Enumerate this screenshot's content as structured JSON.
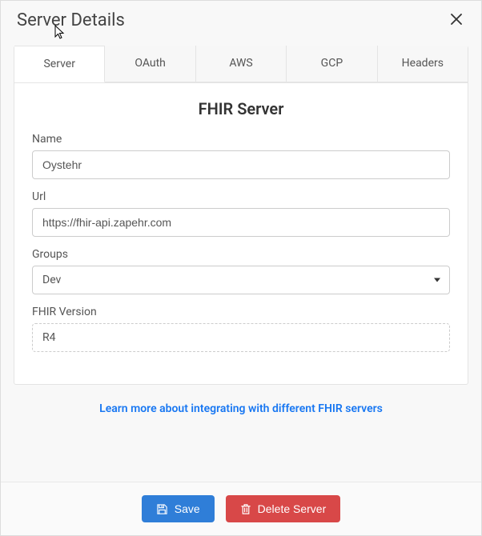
{
  "modal": {
    "title": "Server Details"
  },
  "tabs": {
    "items": [
      {
        "label": "Server"
      },
      {
        "label": "OAuth"
      },
      {
        "label": "AWS"
      },
      {
        "label": "GCP"
      },
      {
        "label": "Headers"
      }
    ],
    "activeIndex": 0
  },
  "form": {
    "sectionTitle": "FHIR Server",
    "name": {
      "label": "Name",
      "value": "Oystehr"
    },
    "url": {
      "label": "Url",
      "value": "https://fhir-api.zapehr.com"
    },
    "groups": {
      "label": "Groups",
      "value": "Dev"
    },
    "fhirVersion": {
      "label": "FHIR Version",
      "value": "R4"
    }
  },
  "links": {
    "learnMore": "Learn more about integrating with different FHIR servers"
  },
  "buttons": {
    "save": "Save",
    "delete": "Delete Server"
  }
}
